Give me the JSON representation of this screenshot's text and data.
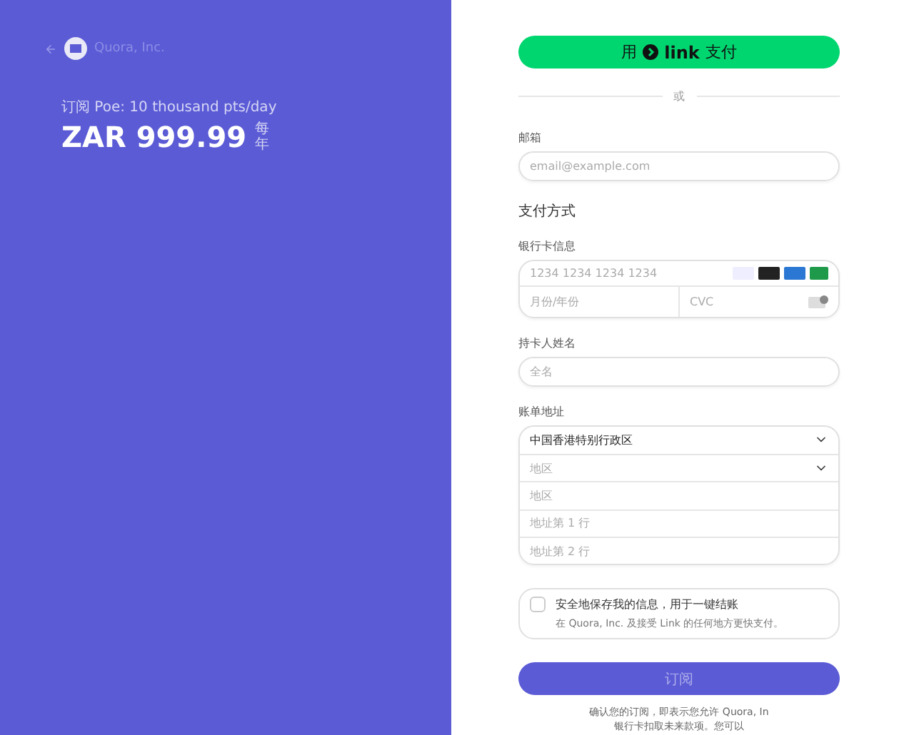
{
  "header": {
    "merchant": "Quora, Inc."
  },
  "product": {
    "title": "订阅 Poe: 10 thousand pts/day",
    "price": "ZAR 999.99",
    "period": "每年"
  },
  "link_button": {
    "before": "用",
    "brand": "link",
    "after": "支付"
  },
  "divider": "或",
  "email": {
    "label": "邮箱",
    "placeholder": "email@example.com"
  },
  "payment": {
    "heading": "支付方式",
    "card_label": "银行卡信息",
    "number_placeholder": "1234 1234 1234 1234",
    "expiry_placeholder": "月份/年份",
    "cvc_placeholder": "CVC"
  },
  "cardholder": {
    "label": "持卡人姓名",
    "placeholder": "全名"
  },
  "billing": {
    "label": "账单地址",
    "rows": [
      {
        "kind": "select",
        "value": "中国香港特别行政区"
      },
      {
        "kind": "select",
        "placeholder": "地区"
      },
      {
        "kind": "input",
        "placeholder": "地区"
      },
      {
        "kind": "input",
        "placeholder": "地址第 1 行"
      },
      {
        "kind": "input",
        "placeholder": "地址第 2 行"
      }
    ]
  },
  "save_info": {
    "checked": false,
    "title": "安全地保存我的信息，用于一键结账",
    "subtitle": "在 Quora, Inc. 及接受 Link 的任何地方更快支付。"
  },
  "subscribe_button": {
    "label": "订阅",
    "disabled": true
  },
  "terms": [
    "确认您的订阅，即表示您允许 Quora, In",
    "银行卡扣取未来款项。您可以"
  ]
}
